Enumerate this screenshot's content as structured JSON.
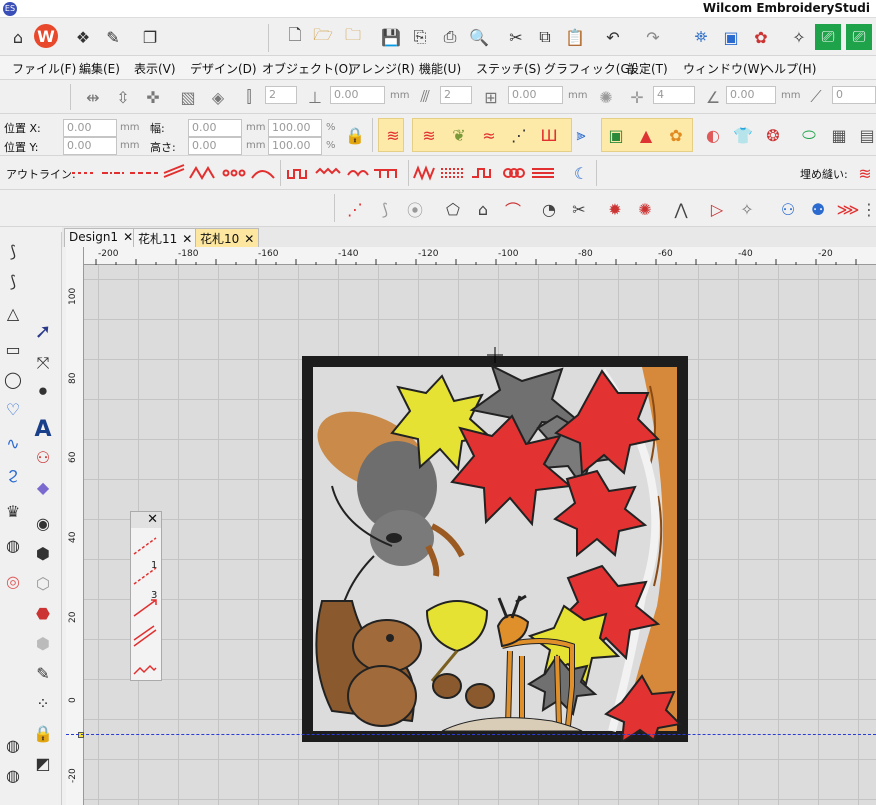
{
  "app": {
    "title": "Wilcom EmbroideryStudi"
  },
  "menu": [
    "ファイル(F)",
    "編集(E)",
    "表示(V)",
    "デザイン(D)",
    "オブジェクト(O)",
    "アレンジ(R)",
    "機能(U)",
    "ステッチ(S)",
    "グラフィック(G)",
    "設定(T)",
    "ウィンドウ(W)",
    "ヘルプ(H)"
  ],
  "toolbar3": {
    "spin1": "2",
    "field1": "0.00",
    "unit_mm": "mm",
    "spin2": "2",
    "field2": "0.00",
    "field3": "0.00",
    "spin3": "4",
    "field4": "0.00",
    "field5": "0"
  },
  "props": {
    "pos_x_label": "位置 X:",
    "pos_y_label": "位置 Y:",
    "width_label": "幅:",
    "height_label": "高さ:",
    "pos_x": "0.00",
    "pos_y": "0.00",
    "width": "0.00",
    "height": "0.00",
    "unit": "mm",
    "scale_w": "100.00",
    "scale_h": "100.00",
    "pct": "%"
  },
  "outline": {
    "label": "アウトライン:",
    "fill_label": "埋め縫い:"
  },
  "tabs": [
    {
      "label": "Design1"
    },
    {
      "label": "花札11"
    },
    {
      "label": "花札10",
      "active": true
    }
  ],
  "ruler": {
    "h_labels": [
      "-200",
      "-180",
      "-160",
      "-140",
      "-120",
      "-100",
      "-80",
      "-60",
      "-40",
      "-20"
    ],
    "v_labels": [
      "100",
      "80",
      "60",
      "40",
      "20",
      "0",
      "-20"
    ]
  },
  "float_panel": {
    "items": [
      "1",
      "3"
    ]
  },
  "icons": [
    "home-icon",
    "wilcom-logo-icon",
    "new-file-icon",
    "open-folder-icon",
    "save-icon",
    "print-icon",
    "cut-icon",
    "copy-icon",
    "paste-icon",
    "undo-icon",
    "redo-icon",
    "close-icon",
    "select-arrow-icon",
    "text-A-icon"
  ],
  "colors": {
    "accent_tab": "#fde7a0",
    "guide": "#2a3bd6",
    "leaf_red": "#e23232",
    "leaf_yellow": "#e6e233",
    "leaf_gray": "#707070",
    "frame": "#1d1d1d",
    "bark": "#d6893a"
  }
}
